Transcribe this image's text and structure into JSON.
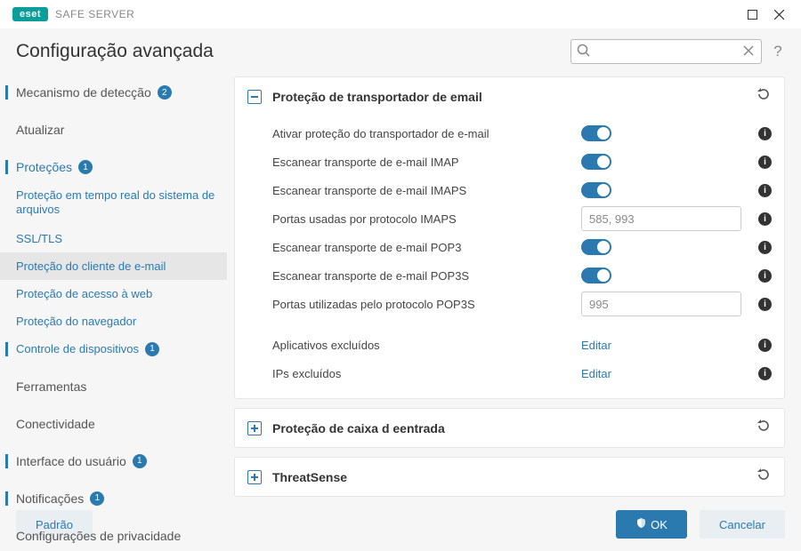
{
  "app": {
    "brand": "eset",
    "name": "SAFE SERVER"
  },
  "page_title": "Configuração avançada",
  "search": {
    "placeholder": ""
  },
  "sidebar": {
    "items": [
      {
        "label": "Mecanismo de detecção",
        "badge": "2"
      },
      {
        "label": "Atualizar"
      },
      {
        "label": "Proteções",
        "badge": "1"
      }
    ],
    "sub": [
      {
        "label": "Proteção em tempo real do sistema de arquivos"
      },
      {
        "label": "SSL/TLS"
      },
      {
        "label": "Proteção do cliente de e-mail"
      },
      {
        "label": "Proteção de acesso à web"
      },
      {
        "label": "Proteção do navegador"
      },
      {
        "label": "Controle de dispositivos",
        "badge": "1"
      }
    ],
    "after": [
      {
        "label": "Ferramentas"
      },
      {
        "label": "Conectividade"
      },
      {
        "label": "Interface do usuário",
        "badge": "1"
      },
      {
        "label": "Notificações",
        "badge": "1"
      },
      {
        "label": "Configurações de privacidade"
      }
    ]
  },
  "panels": {
    "main_title": "Proteção de transportador de email",
    "rows": [
      {
        "label": "Ativar proteção do transportador de e-mail"
      },
      {
        "label": "Escanear transporte de e-mail IMAP"
      },
      {
        "label": "Escanear transporte de e-mail IMAPS"
      },
      {
        "label": "Portas usadas por protocolo IMAPS",
        "value": "585, 993"
      },
      {
        "label": "Escanear transporte de e-mail POP3"
      },
      {
        "label": "Escanear transporte de e-mail POP3S"
      },
      {
        "label": "Portas utilizadas pelo protocolo POP3S",
        "value": "995"
      }
    ],
    "excluded_apps_label": "Aplicativos excluídos",
    "excluded_ips_label": "IPs excluídos",
    "edit_label": "Editar",
    "collapsed1": "Proteção de caixa d eentrada",
    "collapsed2": "ThreatSense"
  },
  "footer": {
    "default": "Padrão",
    "ok": "OK",
    "cancel": "Cancelar"
  }
}
